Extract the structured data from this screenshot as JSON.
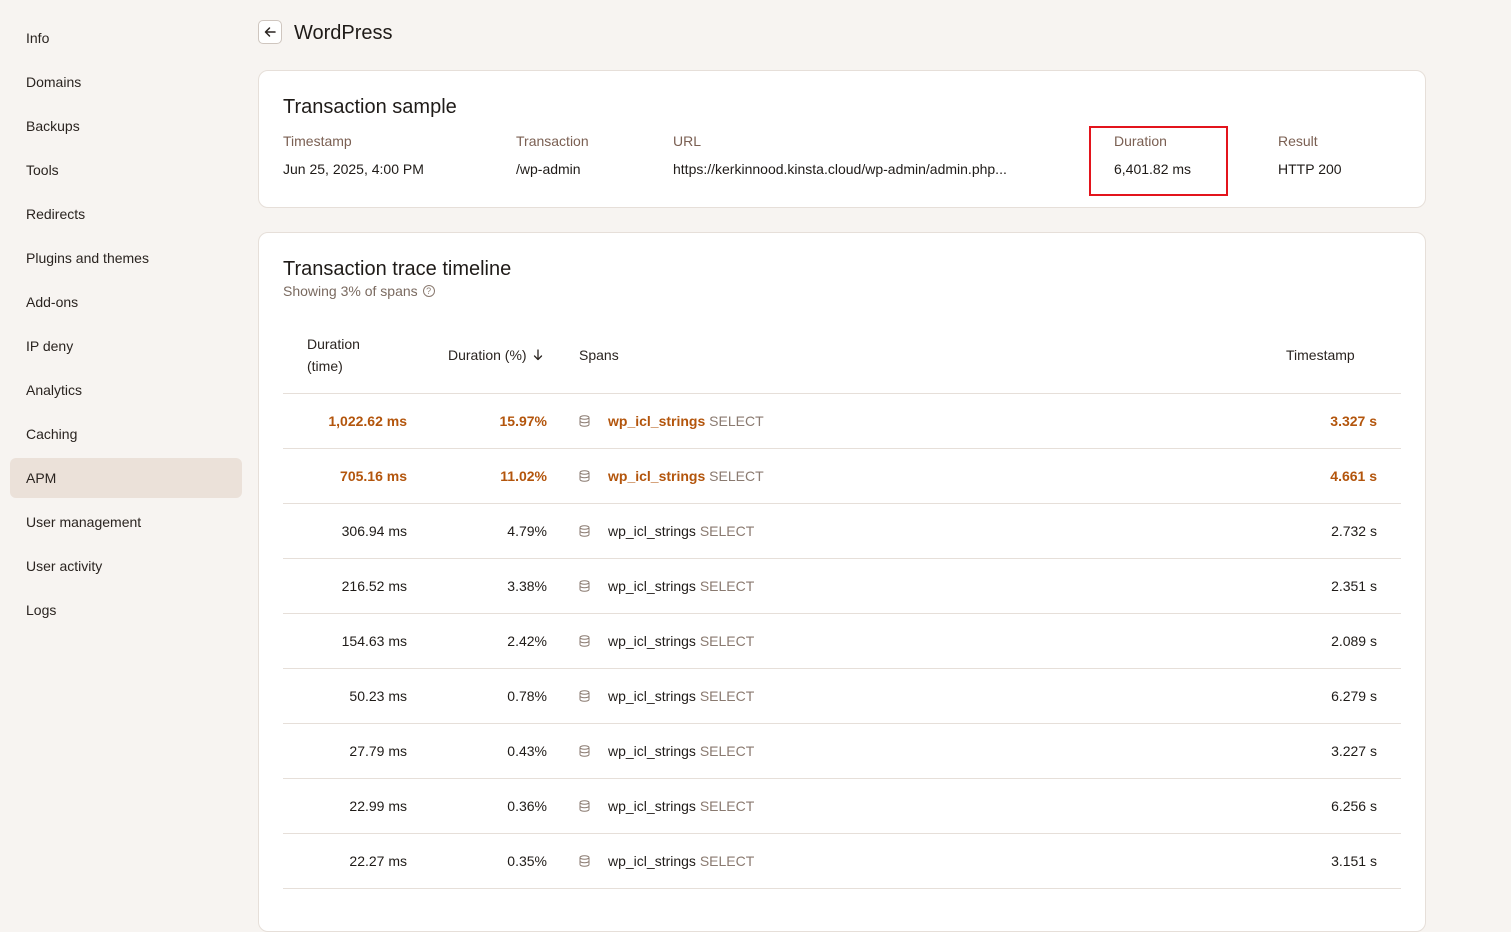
{
  "sidebar": {
    "items": [
      {
        "label": "Info"
      },
      {
        "label": "Domains"
      },
      {
        "label": "Backups"
      },
      {
        "label": "Tools"
      },
      {
        "label": "Redirects"
      },
      {
        "label": "Plugins and themes"
      },
      {
        "label": "Add-ons"
      },
      {
        "label": "IP deny"
      },
      {
        "label": "Analytics"
      },
      {
        "label": "Caching"
      },
      {
        "label": "APM",
        "active": true
      },
      {
        "label": "User management"
      },
      {
        "label": "User activity"
      },
      {
        "label": "Logs"
      }
    ]
  },
  "header": {
    "title": "WordPress",
    "back_icon": "arrow-left-icon"
  },
  "sample": {
    "title": "Transaction sample",
    "timestamp_label": "Timestamp",
    "timestamp_value": "Jun 25, 2025, 4:00 PM",
    "transaction_label": "Transaction",
    "transaction_value": "/wp-admin",
    "url_label": "URL",
    "url_value": "https://kerkinnood.kinsta.cloud/wp-admin/admin.php...",
    "duration_label": "Duration",
    "duration_value": "6,401.82 ms",
    "result_label": "Result",
    "result_value": "HTTP 200"
  },
  "trace": {
    "title": "Transaction trace timeline",
    "subtitle": "Showing 3% of spans",
    "columns": {
      "duration_time_line1": "Duration",
      "duration_time_line2": "(time)",
      "duration_pct": "Duration (%)",
      "spans": "Spans",
      "timestamp": "Timestamp"
    },
    "rows": [
      {
        "duration": "1,022.62 ms",
        "pct": "15.97%",
        "span": "wp_icl_strings",
        "op": "SELECT",
        "ts": "3.327 s",
        "hot": true
      },
      {
        "duration": "705.16 ms",
        "pct": "11.02%",
        "span": "wp_icl_strings",
        "op": "SELECT",
        "ts": "4.661 s",
        "hot": true
      },
      {
        "duration": "306.94 ms",
        "pct": "4.79%",
        "span": "wp_icl_strings",
        "op": "SELECT",
        "ts": "2.732 s"
      },
      {
        "duration": "216.52 ms",
        "pct": "3.38%",
        "span": "wp_icl_strings",
        "op": "SELECT",
        "ts": "2.351 s"
      },
      {
        "duration": "154.63 ms",
        "pct": "2.42%",
        "span": "wp_icl_strings",
        "op": "SELECT",
        "ts": "2.089 s"
      },
      {
        "duration": "50.23 ms",
        "pct": "0.78%",
        "span": "wp_icl_strings",
        "op": "SELECT",
        "ts": "6.279 s"
      },
      {
        "duration": "27.79 ms",
        "pct": "0.43%",
        "span": "wp_icl_strings",
        "op": "SELECT",
        "ts": "3.227 s"
      },
      {
        "duration": "22.99 ms",
        "pct": "0.36%",
        "span": "wp_icl_strings",
        "op": "SELECT",
        "ts": "6.256 s"
      },
      {
        "duration": "22.27 ms",
        "pct": "0.35%",
        "span": "wp_icl_strings",
        "op": "SELECT",
        "ts": "3.151 s"
      }
    ]
  },
  "colors": {
    "background": "#f7f4f1",
    "active_nav": "#ebe1d9",
    "label_brown": "#7a5f52",
    "hot_orange": "#b3550c",
    "highlight_red": "#e3141c"
  }
}
